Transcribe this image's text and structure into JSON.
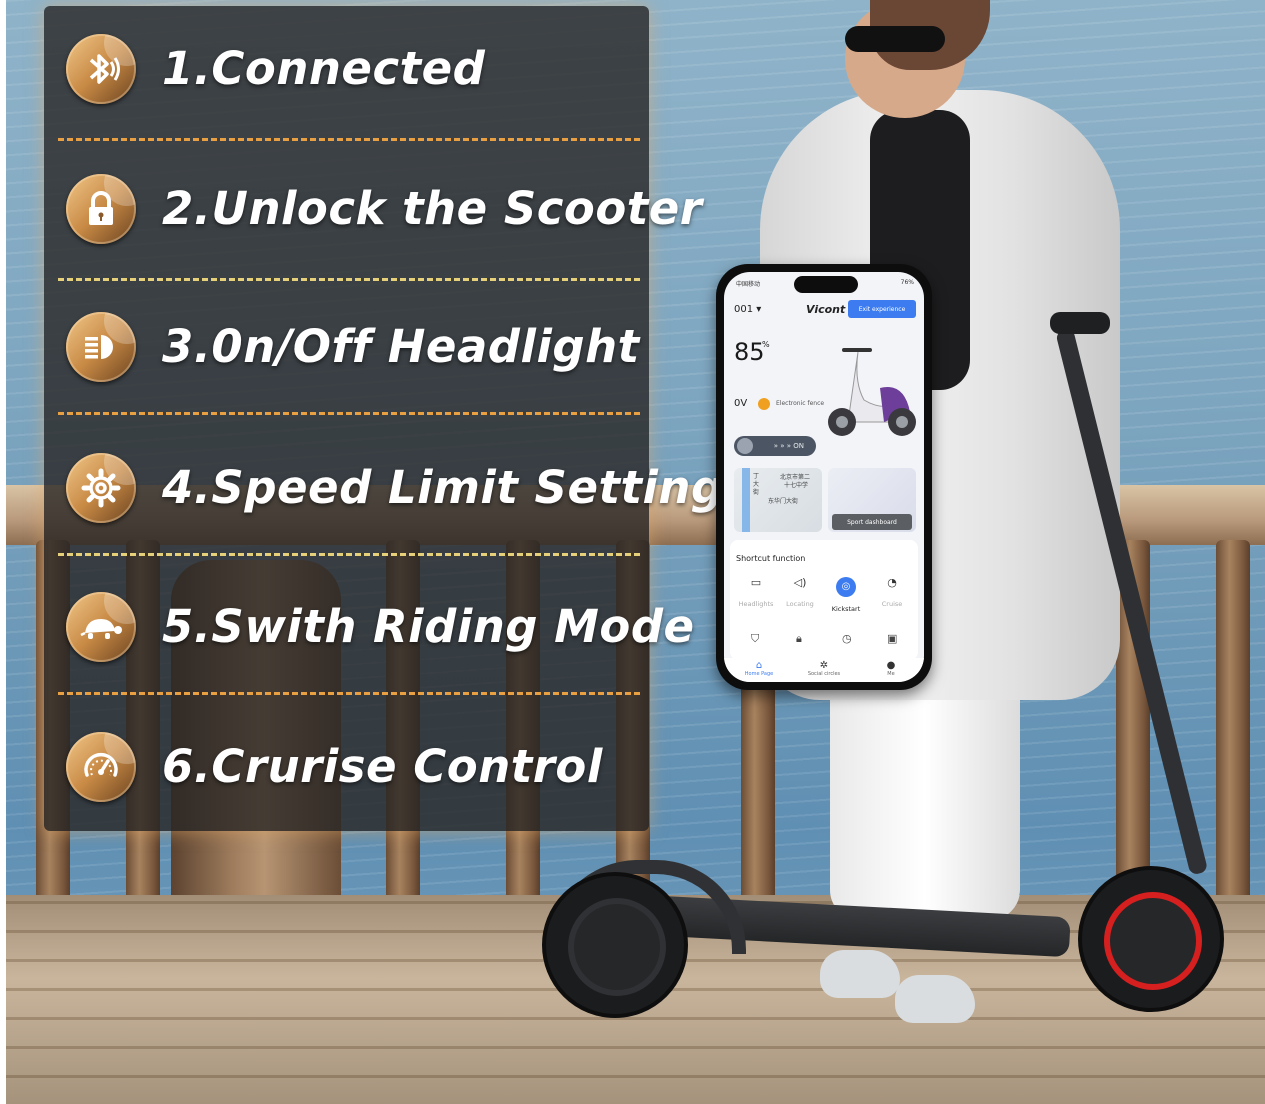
{
  "features": [
    {
      "label": "1.Connected",
      "icon": "bluetooth-icon"
    },
    {
      "label": "2.Unlock the Scooter",
      "icon": "padlock-icon"
    },
    {
      "label": "3.0n/Off Headlight",
      "icon": "headlight-icon"
    },
    {
      "label": "4.Speed Limit Setting",
      "icon": "gear-icon"
    },
    {
      "label": "5.Swith Riding Mode",
      "icon": "turtle-icon"
    },
    {
      "label": "6.Crurise Control",
      "icon": "speedometer-icon"
    }
  ],
  "colors": {
    "accent": "#e8a042",
    "icon_gold": "#c88a45",
    "panel": "#282624",
    "app_blue": "#3c7cf0"
  },
  "phone": {
    "status_left": "中国移动",
    "status_right": "76%",
    "device_id": "001 ▾",
    "brand": "Vicont",
    "exit_button": "Exit experience",
    "battery_value": "85",
    "battery_unit": "%",
    "voltage": "0V",
    "fence_label": "Electronic fence",
    "power_label": "» » » ON",
    "map_labels": [
      "北京市第二",
      "十七中学",
      "东华门大街",
      "丁",
      "大",
      "街"
    ],
    "sport_button": "Sport dashboard",
    "shortcut_title": "Shortcut function",
    "shortcuts": [
      {
        "label": "Headlights",
        "icon": "headlight-icon"
      },
      {
        "label": "Locating",
        "icon": "speaker-icon"
      },
      {
        "label": "Kickstart",
        "icon": "kickstart-icon"
      },
      {
        "label": "Cruise",
        "icon": "cruise-icon"
      }
    ],
    "tabs": [
      {
        "label": "Home Page",
        "icon": "home-icon"
      },
      {
        "label": "Social circles",
        "icon": "social-icon"
      },
      {
        "label": "Me",
        "icon": "user-icon"
      }
    ]
  }
}
